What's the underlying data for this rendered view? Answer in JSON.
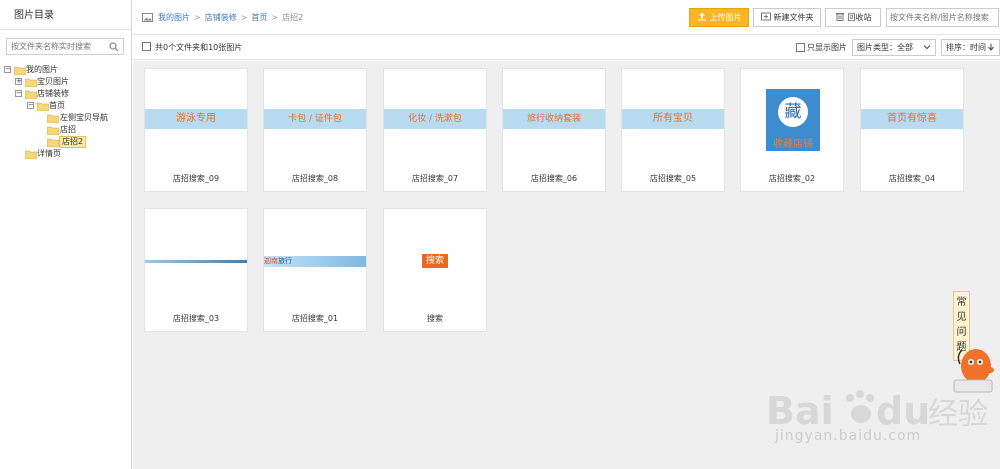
{
  "sidebar": {
    "title": "图片目录",
    "search_placeholder": "按文件夹名称实时搜索",
    "tree": [
      {
        "label": "我的图片",
        "expander": "−"
      },
      {
        "label": "宝贝图片",
        "expander": "+"
      },
      {
        "label": "店铺装修",
        "expander": "−"
      },
      {
        "label": "首页",
        "expander": "−"
      },
      {
        "label": "左侧宝贝导航"
      },
      {
        "label": "店招"
      },
      {
        "label": "店招2",
        "selected": true
      },
      {
        "label": "详情页"
      }
    ]
  },
  "breadcrumb": {
    "items": [
      "我的图片",
      "店铺装修",
      "首页"
    ],
    "current": "店招2"
  },
  "toolbar": {
    "upload_label": "上传图片",
    "new_folder_label": "新建文件夹",
    "recycle_label": "回收站",
    "search_placeholder": "按文件夹名称/图片名称搜索"
  },
  "infobar": {
    "count_text": "共0个文件夹和10张图片",
    "only_images_label": "只显示图片",
    "type_label": "图片类型：",
    "type_value": "全部",
    "sort_label": "排序：",
    "sort_value": "时间"
  },
  "images": [
    {
      "name": "店招搜索_09",
      "banner": "游泳专用"
    },
    {
      "name": "店招搜索_08",
      "banner": "卡包 / 证件包"
    },
    {
      "name": "店招搜索_07",
      "banner": "化妆 / 洗漱包"
    },
    {
      "name": "店招搜索_06",
      "banner": "旅行收纳套装"
    },
    {
      "name": "店招搜索_05",
      "banner": "所有宝贝"
    },
    {
      "name": "店招搜索_02",
      "banner_top": "藏",
      "banner_bottom": "收藏店铺"
    },
    {
      "name": "店招搜索_04",
      "banner": "首页有惊喜"
    },
    {
      "name": "店招搜索_03"
    },
    {
      "name": "店招搜索_01",
      "banner_a": "迦南",
      "banner_b": "旅行"
    },
    {
      "name": "搜索",
      "banner": "搜索"
    }
  ],
  "faq": {
    "label_1": "常",
    "label_2": "见",
    "label_3": "问",
    "label_4": "题"
  },
  "watermark": {
    "url": "jingyan.baidu.com"
  }
}
